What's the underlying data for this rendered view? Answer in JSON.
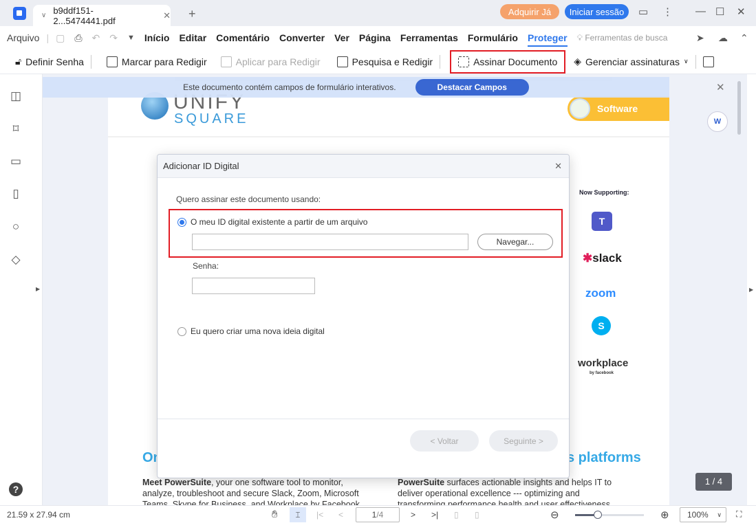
{
  "titlebar": {
    "tab_title": "b9ddf151-2...5474441.pdf",
    "buy_label": "Adquirir Já",
    "login_label": "Iniciar sessão"
  },
  "menu": {
    "file": "Arquivo",
    "items": [
      "Início",
      "Editar",
      "Comentário",
      "Converter",
      "Ver",
      "Página",
      "Ferramentas",
      "Formulário",
      "Proteger"
    ],
    "active": "Proteger",
    "search_tools": "Ferramentas de busca"
  },
  "toolbar": {
    "set_password": "Definir Senha",
    "mark_redact": "Marcar para Redigir",
    "apply_redact": "Aplicar para Redigir",
    "search_redact": "Pesquisa e Redigir",
    "sign_document": "Assinar Documento",
    "manage_signatures": "Gerenciar assinaturas"
  },
  "banner": {
    "text": "Este documento contém campos de formulário interativos.",
    "button": "Destacar Campos"
  },
  "pdf": {
    "logo_top": "UNIFY",
    "logo_bottom": "SQUARE",
    "badge": "Software",
    "now_supporting": "Now Supporting:",
    "apps": [
      "slack",
      "zoom",
      "workplace"
    ],
    "workplace_by": "by facebook",
    "heading_left": "On",
    "heading_right": "s platforms",
    "col1_bold": "Meet PowerSuite",
    "col1_text": ", your one software tool to monitor, analyze, troubleshoot and secure Slack, Zoom, Microsoft Teams, Skype for Business, and Workplace by Facebook platforms",
    "col2_bold": "PowerSuite",
    "col2_text": " surfaces actionable insights and helps IT to deliver operational excellence --- optimizing and transforming performance health and user effectiveness"
  },
  "dialog": {
    "title": "Adicionar ID Digital",
    "prompt": "Quero assinar este documento usando:",
    "option1": "O meu ID digital existente a partir de um arquivo",
    "browse": "Navegar...",
    "password_label": "Senha:",
    "option2": "Eu quero criar uma nova ideia digital",
    "back": "< Voltar",
    "next": "Seguinte >",
    "file_value": "",
    "password_value": ""
  },
  "status": {
    "page_size": "21.59 x 27.94 cm",
    "page_input": "1",
    "page_total": "/4",
    "zoom": "100%",
    "page_badge": "1 / 4",
    "zoom_level_fraction": 0.33
  },
  "colors": {
    "accent": "#2f78ec",
    "highlight_box": "#e21c24",
    "buy": "#f5a26b"
  }
}
